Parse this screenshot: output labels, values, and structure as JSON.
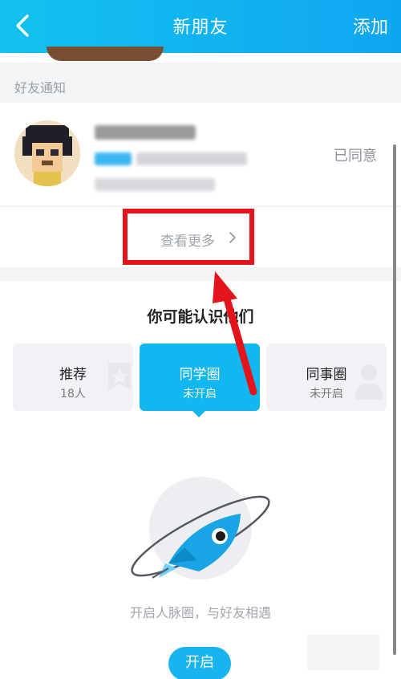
{
  "header": {
    "back_icon": "chevron-left-icon",
    "title": "新朋友",
    "add_label": "添加"
  },
  "notifications": {
    "section_label": "好友通知",
    "item": {
      "status": "已同意"
    },
    "show_more_label": "查看更多"
  },
  "suggestions": {
    "title": "你可能认识他们",
    "tabs": [
      {
        "label": "推荐",
        "sub": "18人",
        "active": false
      },
      {
        "label": "同学圈",
        "sub": "未开启",
        "active": true
      },
      {
        "label": "同事圈",
        "sub": "未开启",
        "active": false
      }
    ],
    "illustration": "rocket-planet-icon",
    "tagline": "开启人脉圈，与好友相遇",
    "open_button_label": "开启"
  },
  "colors": {
    "header_blue": "#13c2ef",
    "accent_blue": "#12b7f0",
    "annotation_red": "#e3141b"
  }
}
